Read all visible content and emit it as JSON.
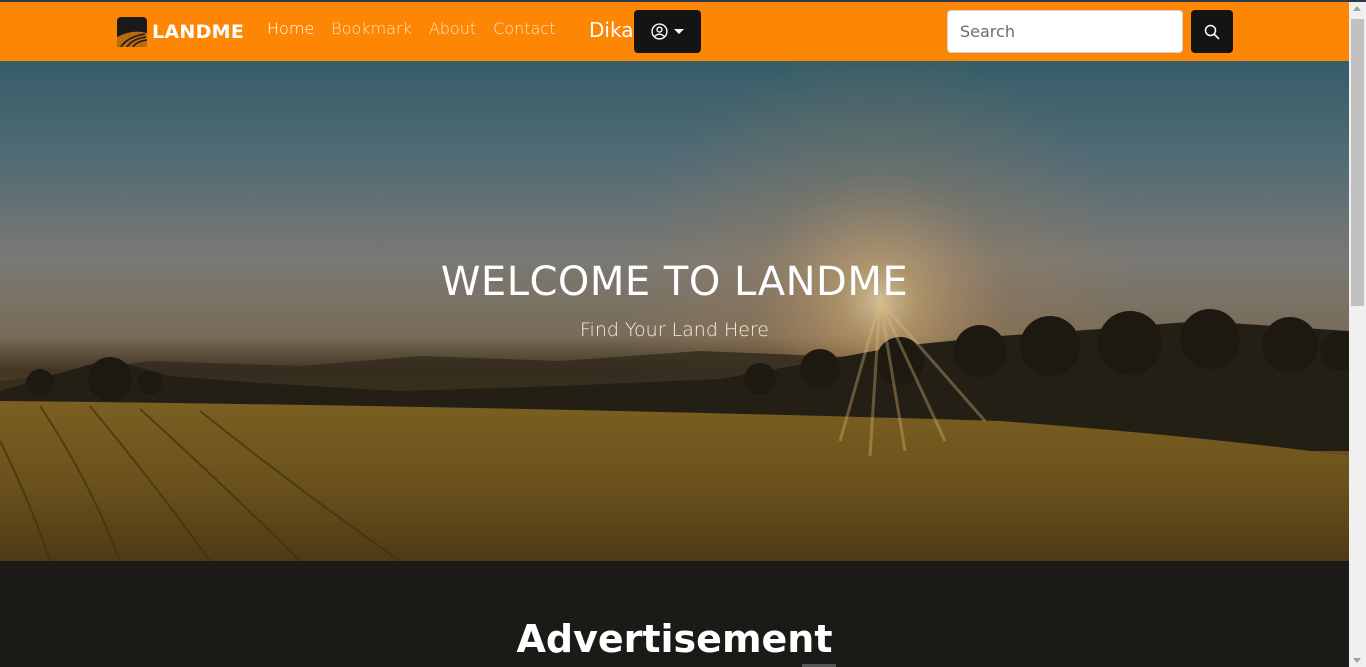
{
  "brand": {
    "name": "LANDME"
  },
  "nav": {
    "items": [
      {
        "label": "Home",
        "active": true
      },
      {
        "label": "Bookmark",
        "active": false
      },
      {
        "label": "About",
        "active": false
      },
      {
        "label": "Contact",
        "active": false
      }
    ],
    "username": "Dika"
  },
  "user_menu": {
    "icon": "user-circle-icon"
  },
  "search": {
    "placeholder": "Search",
    "value": "",
    "button_icon": "search-icon"
  },
  "hero": {
    "title": "WELCOME TO LANDME",
    "subtitle": "Find Your Land Here"
  },
  "advertisement": {
    "title": "Advertisement"
  },
  "colors": {
    "navbar": "#fd8604",
    "button_dark": "#141414",
    "section_dark": "#1c1a17"
  }
}
